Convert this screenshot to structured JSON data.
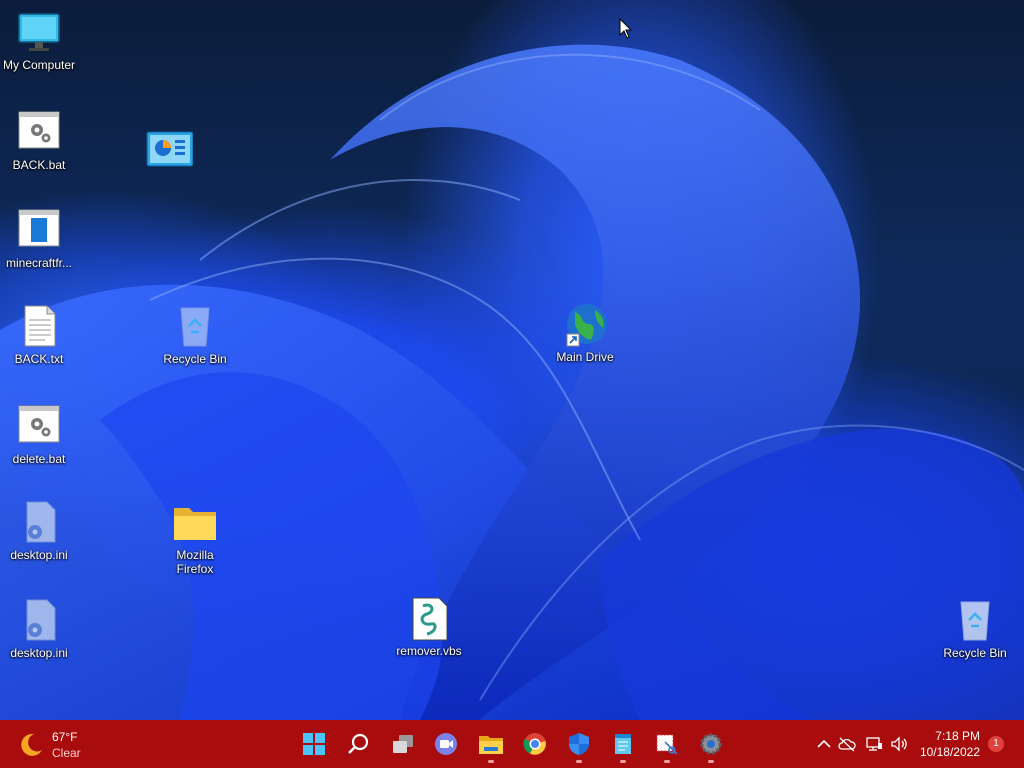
{
  "desktop": {
    "icons": [
      {
        "label": "My Computer",
        "icon": "monitor-icon"
      },
      {
        "label": "BACK.bat",
        "icon": "batch-file-icon"
      },
      {
        "label": "minecraftfr...",
        "icon": "app-window-icon"
      },
      {
        "label": "BACK.txt",
        "icon": "text-file-icon"
      },
      {
        "label": "delete.bat",
        "icon": "batch-file-icon"
      },
      {
        "label": "desktop.ini",
        "icon": "ini-file-icon"
      },
      {
        "label": "desktop.ini",
        "icon": "ini-file-icon"
      },
      {
        "label": "Recycle Bin",
        "icon": "recycle-bin-icon"
      },
      {
        "label": "Mozilla Firefox",
        "icon": "folder-icon"
      },
      {
        "label": "Main Drive",
        "icon": "globe-shortcut-icon"
      },
      {
        "label": "remover.vbs",
        "icon": "script-file-icon"
      },
      {
        "label": "Recycle Bin",
        "icon": "recycle-bin-icon"
      }
    ]
  },
  "taskbar": {
    "color": "#a80c0c",
    "weather": {
      "temp": "67°F",
      "condition": "Clear",
      "icon": "moon-icon"
    },
    "apps": [
      "start-icon",
      "search-icon",
      "task-view-icon",
      "teams-chat-icon",
      "file-explorer-icon",
      "chrome-icon",
      "defender-icon",
      "notepad-icon",
      "snipping-tool-icon",
      "settings-icon"
    ],
    "tray": [
      "chevron-up-icon",
      "cloud-off-icon",
      "network-icon",
      "volume-icon"
    ],
    "clock": {
      "time": "7:18 PM",
      "date": "10/18/2022"
    },
    "notification_count": "1"
  }
}
